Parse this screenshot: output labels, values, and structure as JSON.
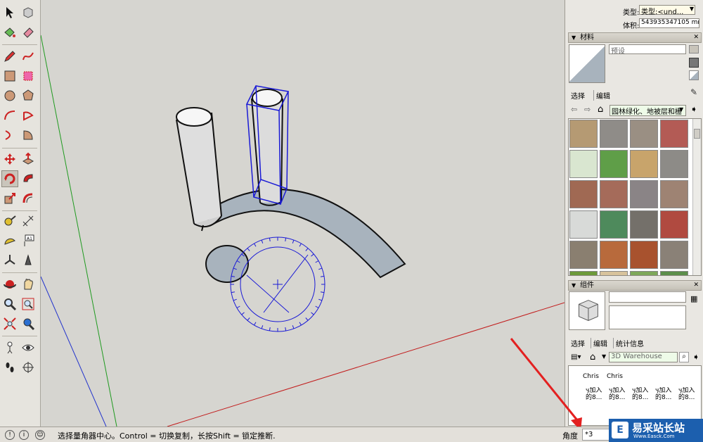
{
  "entity_info": {
    "type_label": "类型:",
    "type_value": "类型:<und...",
    "volume_label": "体积:",
    "volume_value": "543935347105 mm³"
  },
  "materials_panel": {
    "title": "材料",
    "name_placeholder": "预设",
    "tab_select": "选择",
    "tab_edit": "编辑",
    "library": "园林绿化、地被层和栅",
    "swatch_colors": [
      "#b59a73",
      "#8f8c88",
      "#9a8f83",
      "#b35b55",
      "#d9e6d0",
      "#5f9e48",
      "#c8a46b",
      "#8d8b87",
      "#a06953",
      "#a56b5a",
      "#8a8486",
      "#9e8373",
      "#d8dad8",
      "#4e8a5c",
      "#74706a",
      "#b04a40",
      "#8a7f70",
      "#b86a3c",
      "#a8522e",
      "#8a8177",
      "#6d9a3a",
      "#d8c39c",
      "#7ea85a",
      "#5c8e4a"
    ]
  },
  "components_panel": {
    "title": "组件",
    "tab_select": "选择",
    "tab_edit": "编辑",
    "tab_stats": "统计信息",
    "search_placeholder": "3D Warehouse",
    "items": [
      "Chris",
      "Chris",
      "ӌ加入\n的8...",
      "ӌ加入\n的8...",
      "ӌ加入\n的8...",
      "ӌ加入\n的8...",
      "ӌ加入\n的8..."
    ]
  },
  "toolbar": {
    "tools": [
      "select-icon",
      "make-component-icon",
      "paint-bucket-icon",
      "eraser-icon",
      "pencil-icon",
      "freehand-icon",
      "rectangle-icon",
      "rotated-rectangle-icon",
      "circle-icon",
      "polygon-icon",
      "arc-icon",
      "pie-icon",
      "two-point-arc-icon",
      "three-point-arc-icon",
      "move-icon",
      "push-pull-icon",
      "rotate-icon",
      "follow-me-icon",
      "scale-icon",
      "offset-icon",
      "tape-measure-icon",
      "dimension-icon",
      "protractor-icon",
      "text-icon",
      "axes-icon",
      "3d-text-icon",
      "orbit-icon",
      "pan-icon",
      "zoom-icon",
      "zoom-window-icon",
      "zoom-extents-icon",
      "previous-view-icon",
      "position-camera-icon",
      "look-around-icon",
      "walk-icon",
      "section-plane-icon"
    ]
  },
  "status_bar": {
    "hint": "选择量角器中心。Control = 切换复制，长按Shift = 锁定推断.",
    "measurement_label": "角度",
    "measurement_value": "*3"
  },
  "watermark": {
    "title": "易采站长站",
    "subtitle": "Www.Easck.Com"
  }
}
